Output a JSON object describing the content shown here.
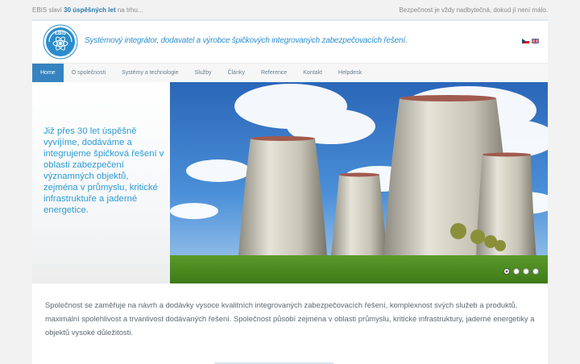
{
  "topbar": {
    "left_prefix": "EBIS slaví",
    "left_highlight": "30 úspěšných let",
    "left_suffix": "na trhu...",
    "right_text": "Bezpečnost je vždy nadbytečná, dokud jí není málo."
  },
  "header": {
    "logo_text": "EBIS",
    "tagline": "Systémový integrátor, dodavatel a výrobce špičkových integrovaných zabezpečovacích řešení.",
    "languages": [
      "cs-flag",
      "en-flag"
    ]
  },
  "nav": {
    "items": [
      {
        "label": "Home",
        "active": true
      },
      {
        "label": "O společnosti",
        "active": false
      },
      {
        "label": "Systémy a technologie",
        "active": false
      },
      {
        "label": "Služby",
        "active": false
      },
      {
        "label": "Články",
        "active": false
      },
      {
        "label": "Reference",
        "active": false
      },
      {
        "label": "Kontakt",
        "active": false
      },
      {
        "label": "Helpdesk",
        "active": false
      }
    ]
  },
  "hero": {
    "text": "Již přes 30 let úspěšně vyvíjíme, dodáváme a integrujeme špičková řešení v oblasti zabezpečení významných objektů, zejména v průmyslu, kritické infrastruktuře a jaderné energetice.",
    "slides": 4,
    "active_slide": 1
  },
  "intro": {
    "text": "Společnost se zaměřuje na návrh a dodávky vysoce kvalitních integrovaných zabezpečovacích řešení, komplexnost svých služeb a produktů, maximální spolehlivost a trvanlivost dodávaných řešení. Společnost působí zejména v oblasti průmyslu, kritické infrastruktury, jaderné energetiky a objektů vysoké důležitosti."
  },
  "colors": {
    "accent": "#3583c0",
    "brand_text": "#2d8fd0",
    "highlight": "#2a7ab0"
  }
}
